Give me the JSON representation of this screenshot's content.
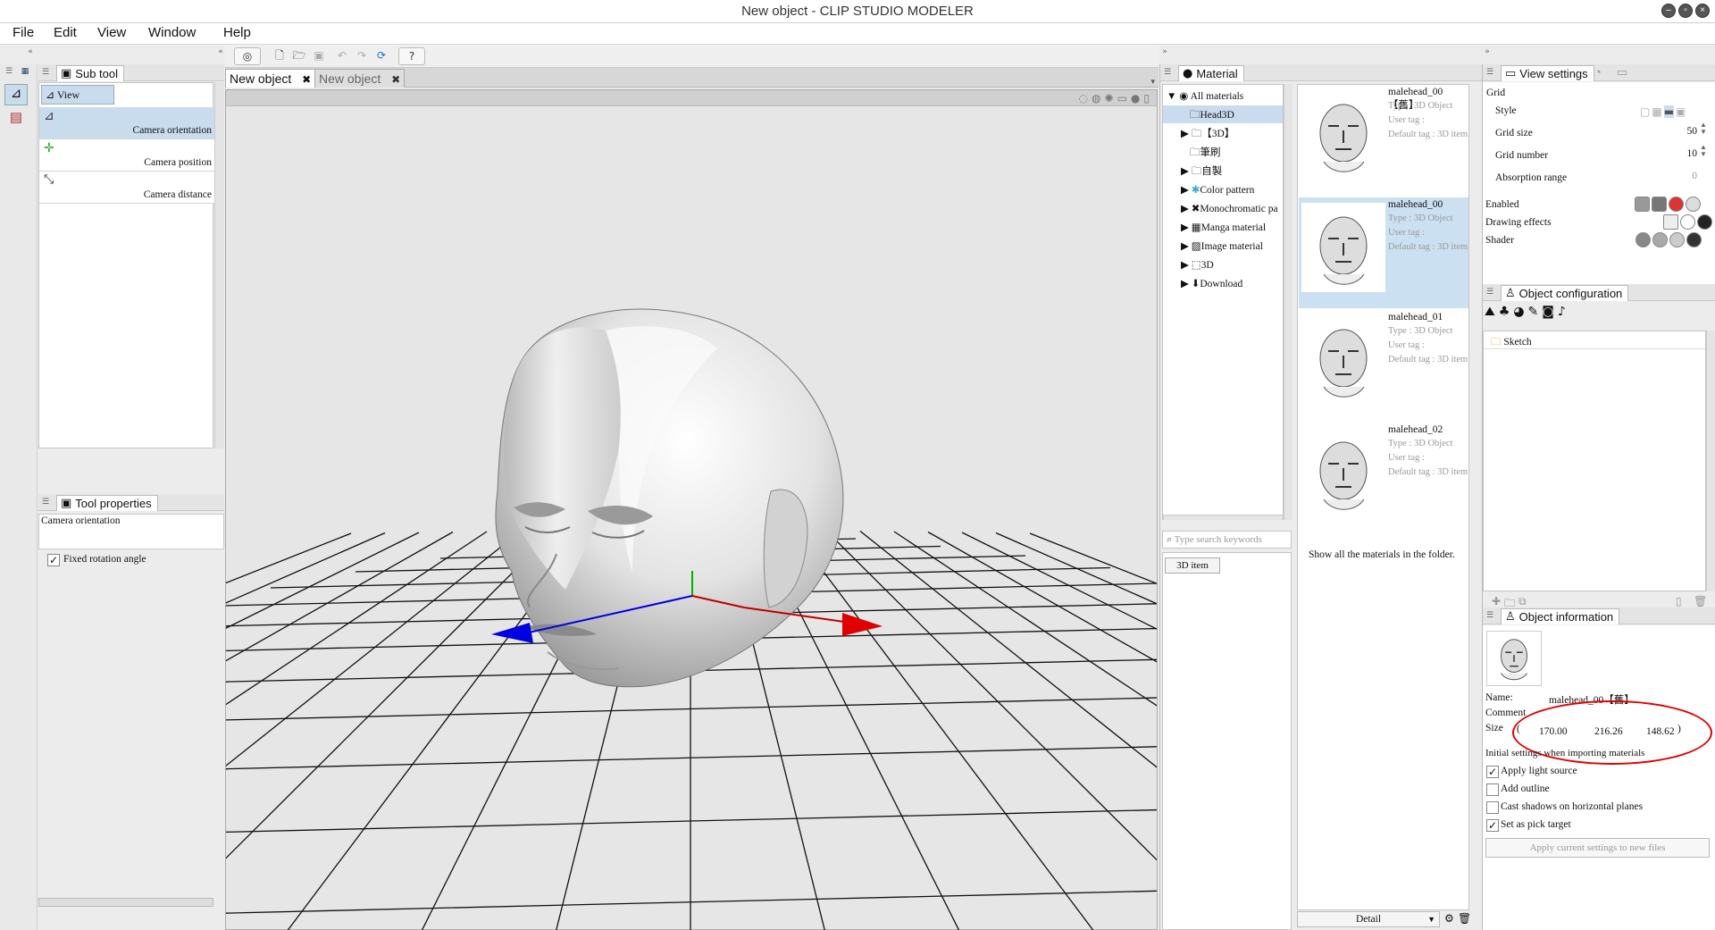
{
  "window": {
    "title": "New object  - CLIP STUDIO MODELER"
  },
  "menu": [
    "File",
    "Edit",
    "View",
    "Window",
    "Help"
  ],
  "subtool": {
    "tab_label": "Sub tool",
    "group_label": "View",
    "items": [
      {
        "label": "Camera orientation",
        "icon": "camera-orientation-icon"
      },
      {
        "label": "Camera position",
        "icon": "camera-position-icon"
      },
      {
        "label": "Camera distance",
        "icon": "camera-distance-icon"
      }
    ]
  },
  "tool_properties": {
    "tab_label": "Tool properties",
    "header": "Camera orientation",
    "fixed_rotation_label": "Fixed rotation angle",
    "fixed_rotation_checked": true
  },
  "documents": {
    "tabs": [
      {
        "label": "New object",
        "active": true
      },
      {
        "label": "New object",
        "active": false
      }
    ]
  },
  "material": {
    "tab_label": "Material",
    "tree": [
      {
        "label": "All materials",
        "expanded": true,
        "level": 0
      },
      {
        "label": "Head3D",
        "level": 1,
        "selected": true
      },
      {
        "label": "【3D】",
        "level": 1,
        "collapsed": true
      },
      {
        "label": "筆刷",
        "level": 1
      },
      {
        "label": "自製",
        "level": 1,
        "collapsed": true
      },
      {
        "label": "Color pattern",
        "level": 1,
        "collapsed": true
      },
      {
        "label": "Monochromatic pa",
        "level": 1,
        "collapsed": true
      },
      {
        "label": "Manga material",
        "level": 1,
        "collapsed": true
      },
      {
        "label": "Image material",
        "level": 1,
        "collapsed": true
      },
      {
        "label": "3D",
        "level": 1,
        "collapsed": true
      },
      {
        "label": "Download",
        "level": 1,
        "collapsed": true
      }
    ],
    "search_placeholder": "Type search keywords",
    "tag_button": "3D item",
    "items": [
      {
        "name": "malehead_00【舊】",
        "type": "Type : 3D Object",
        "user_tag": "User tag :",
        "default_tag": "Default tag : 3D item",
        "selected": false
      },
      {
        "name": "malehead_00",
        "type": "Type : 3D Object",
        "user_tag": "User tag :",
        "default_tag": "Default tag : 3D item",
        "selected": true
      },
      {
        "name": "malehead_01",
        "type": "Type : 3D Object",
        "user_tag": "User tag :",
        "default_tag": "Default tag : 3D item",
        "selected": false
      },
      {
        "name": "malehead_02",
        "type": "Type : 3D Object",
        "user_tag": "User tag :",
        "default_tag": "Default tag : 3D item",
        "selected": false
      }
    ],
    "status_text": "Show all the materials in the folder.",
    "view_mode": "Detail"
  },
  "view_settings": {
    "tab_label": "View settings",
    "grid_label": "Grid",
    "style_label": "Style",
    "grid_size_label": "Grid size",
    "grid_size_value": "50",
    "grid_number_label": "Grid number",
    "grid_number_value": "10",
    "absorption_label": "Absorption range",
    "absorption_value": "0",
    "enabled_label": "Enabled",
    "drawing_effects_label": "Drawing effects",
    "shader_label": "Shader"
  },
  "object_configuration": {
    "tab_label": "Object configuration",
    "root_item": "Sketch"
  },
  "object_information": {
    "tab_label": "Object information",
    "name_label": "Name:",
    "name_value": "malehead_00【舊】",
    "comment_label": "Comment",
    "size_label": "Size",
    "size_open": "(",
    "size_close": ")",
    "size_x": "170.00",
    "size_y": "216.26",
    "size_z": "148.62",
    "initial_settings_label": "Initial settings when importing materials",
    "options": [
      {
        "label": "Apply light source",
        "checked": true
      },
      {
        "label": "Add outline",
        "checked": false
      },
      {
        "label": "Cast shadows on horizontal planes",
        "checked": false
      },
      {
        "label": "Set as pick target",
        "checked": true
      }
    ],
    "apply_button": "Apply current settings to new files"
  },
  "colors": {
    "selection": "#c9dced",
    "highlight_circle": "#e00000",
    "axis_x": "#e00000",
    "axis_y": "#00b000",
    "axis_z": "#0000e0"
  }
}
